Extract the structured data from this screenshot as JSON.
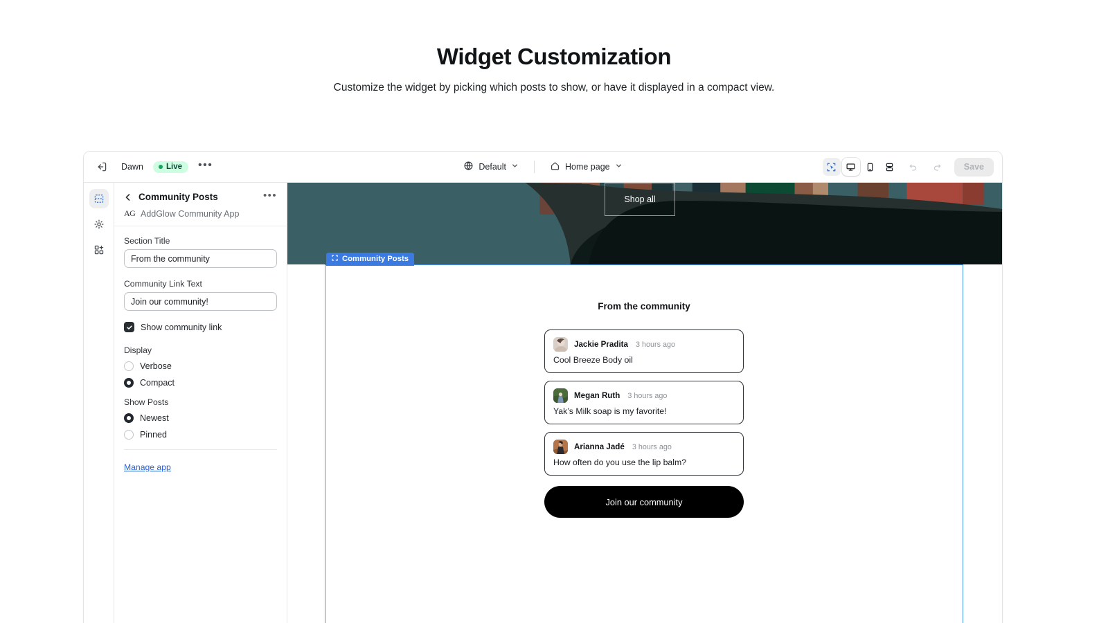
{
  "page": {
    "title": "Widget Customization",
    "subtitle": "Customize the widget by picking which posts to show, or have it displayed in a compact view."
  },
  "topbar": {
    "exit_icon": "exit-icon",
    "theme_name": "Dawn",
    "status_badge": "Live",
    "more_menu": "•••",
    "locale_icon": "globe-icon",
    "locale_value": "Default",
    "page_icon": "home-icon",
    "page_value": "Home page",
    "devices": [
      {
        "name": "select-tool",
        "icon": "cursor-select-icon",
        "active": false,
        "selected_tool": true
      },
      {
        "name": "desktop",
        "icon": "desktop-icon",
        "active": true
      },
      {
        "name": "mobile",
        "icon": "mobile-icon",
        "active": false
      },
      {
        "name": "fullscreen",
        "icon": "fullscreen-icon",
        "active": false
      }
    ],
    "undo_icon": "undo-icon",
    "redo_icon": "redo-icon",
    "save_label": "Save",
    "save_disabled": true
  },
  "rail": {
    "items": [
      {
        "name": "sections",
        "icon": "sections-icon",
        "active": true
      },
      {
        "name": "theme-settings",
        "icon": "gear-icon",
        "active": false
      },
      {
        "name": "apps",
        "icon": "app-blocks-add-icon",
        "active": false
      }
    ]
  },
  "panel": {
    "back_icon": "chevron-left-icon",
    "title": "Community Posts",
    "more_icon": "more-horizontal-icon",
    "app_logo": "AG",
    "app_name": "AddGlow Community App",
    "fields": [
      {
        "label": "Section Title",
        "value": "From the community"
      },
      {
        "label": "Community Link Text",
        "value": "Join our community!"
      }
    ],
    "checkbox": {
      "label": "Show community link",
      "checked": true
    },
    "groups": [
      {
        "title": "Display",
        "options": [
          {
            "label": "Verbose",
            "selected": false
          },
          {
            "label": "Compact",
            "selected": true
          }
        ]
      },
      {
        "title": "Show Posts",
        "options": [
          {
            "label": "Newest",
            "selected": true
          },
          {
            "label": "Pinned",
            "selected": false
          }
        ]
      }
    ],
    "manage_link": "Manage app"
  },
  "canvas": {
    "hero": {
      "shop_all_label": "Shop all",
      "base_color": "#3a6065",
      "dark_color": "#151c1c"
    },
    "section_badge": {
      "label": "Community Posts",
      "icon": "section-select-icon",
      "color": "#3b7ae0"
    },
    "widget": {
      "title": "From the community",
      "posts": [
        {
          "name": "Jackie Pradita",
          "time": "3 hours ago",
          "text": "Cool Breeze Body oil",
          "avatar": "portrait-woman-light"
        },
        {
          "name": "Megan Ruth",
          "time": "3 hours ago",
          "text": "Yak’s Milk soap is my favorite!",
          "avatar": "portrait-outdoor-green"
        },
        {
          "name": "Arianna Jadé",
          "time": "3 hours ago",
          "text": "How often do you use the lip balm?",
          "avatar": "portrait-seated-dark"
        }
      ],
      "cta_label": "Join our community"
    }
  }
}
